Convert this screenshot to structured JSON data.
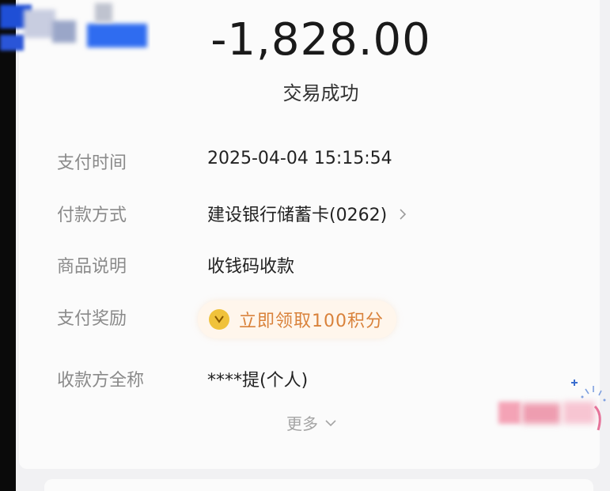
{
  "transaction": {
    "amount": "-1,828.00",
    "status": "交易成功"
  },
  "details": {
    "pay_time_label": "支付时间",
    "pay_time_value": "2025-04-04 15:15:54",
    "payment_method_label": "付款方式",
    "payment_method_value": "建设银行储蓄卡(0262)",
    "description_label": "商品说明",
    "description_value": "收钱码收款",
    "reward_label": "支付奖励",
    "reward_value": "立即领取100积分",
    "payee_label": "收款方全称",
    "payee_value": "****提(个人)"
  },
  "more_label": "更多",
  "colors": {
    "reward_text": "#d9823b",
    "reward_bg": "#fff6ec",
    "coin": "#f0c23b"
  },
  "icons": [
    "chevron-right-icon",
    "coin-icon",
    "chevron-down-icon"
  ]
}
